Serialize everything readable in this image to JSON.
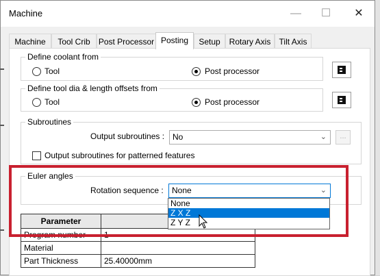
{
  "window": {
    "title": "Machine",
    "minimize_glyph": "—",
    "maximize_glyph": "☐",
    "close_glyph": "✕"
  },
  "tabs": [
    {
      "label": "Machine"
    },
    {
      "label": "Tool Crib"
    },
    {
      "label": "Post Processor"
    },
    {
      "label": "Posting",
      "active": true
    },
    {
      "label": "Setup"
    },
    {
      "label": "Rotary Axis"
    },
    {
      "label": "Tilt Axis"
    }
  ],
  "coolant": {
    "label": "Define coolant from",
    "option_tool": "Tool",
    "option_post": "Post processor",
    "selected": "Post processor"
  },
  "offsets": {
    "label": "Define tool dia & length offsets from",
    "option_tool": "Tool",
    "option_post": "Post processor",
    "selected": "Post processor"
  },
  "subroutines": {
    "label": "Subroutines",
    "output_label": "Output subroutines :",
    "output_value": "No",
    "browse_label": "...",
    "patterned_label": "Output subroutines for patterned features",
    "patterned_checked": false
  },
  "euler": {
    "label": "Euler angles",
    "rotation_label": "Rotation sequence :",
    "rotation_value": "None",
    "options": [
      "None",
      "Z X Z",
      "Z Y Z"
    ],
    "highlighted_option": "Z X Z"
  },
  "param_table": {
    "headers": [
      "Parameter",
      ""
    ],
    "rows": [
      [
        "Program number",
        "1"
      ],
      [
        "Material",
        ""
      ],
      [
        "Part Thickness",
        "25.40000mm"
      ]
    ]
  },
  "colors": {
    "accent": "#0078d7",
    "highlight_box": "#c8202f"
  },
  "icons": {
    "coolant_btn": "post-config-icon",
    "offsets_btn": "post-config-icon",
    "cursor": "mouse-pointer-icon"
  }
}
